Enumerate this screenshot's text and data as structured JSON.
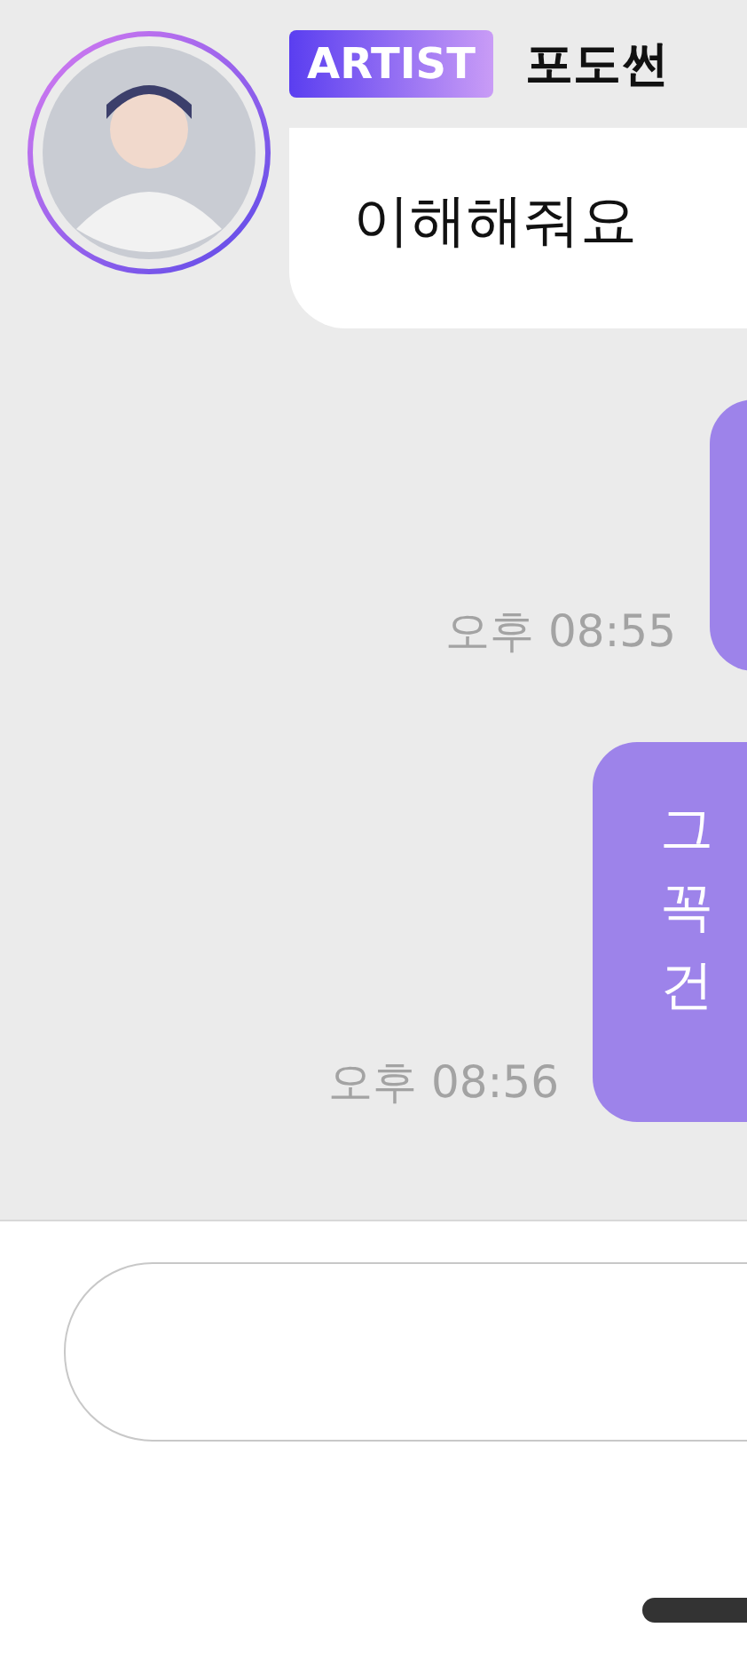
{
  "messages": [
    {
      "kind": "incoming",
      "badge": "ARTIST",
      "sender": "포도썬",
      "lines": [
        "이해해줘요"
      ]
    },
    {
      "kind": "outgoing",
      "time": "오후 08:55"
    },
    {
      "kind": "outgoing",
      "time": "오후 08:56",
      "lines": [
        "그",
        "꼭",
        "건"
      ]
    }
  ],
  "composer": {
    "kind": "field"
  }
}
